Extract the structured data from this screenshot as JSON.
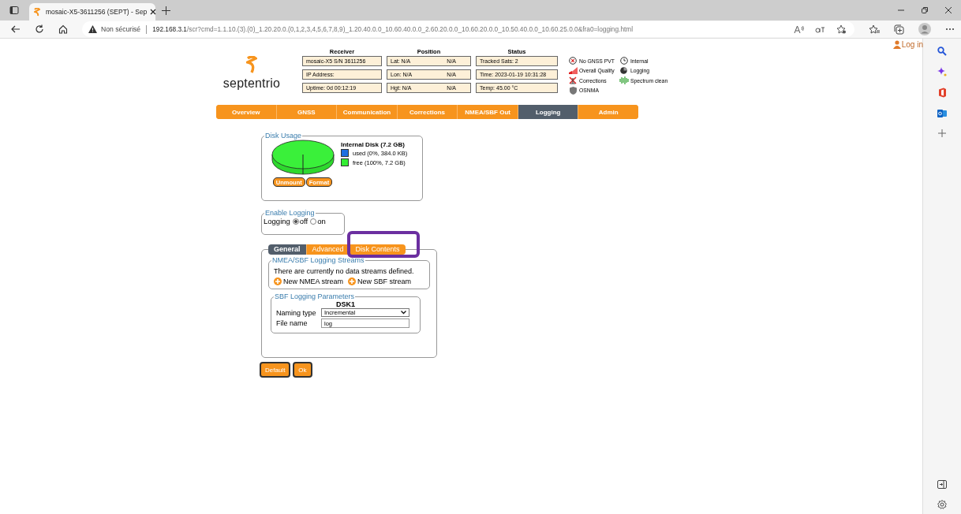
{
  "browser": {
    "tab_title": "mosaic-X5-3611256 (SEPT) - Sep",
    "security": "Non sécurisé",
    "url_host": "192.168.3.1",
    "url_path": "/scr?cmd=1.1.10.(3).(0)_1.20.20.0.(0,1,2,3,4,5,6,7,8,9)_1.20.40.0.0_10.60.40.0.0_2.60.20.0.0_10.60.20.0.0_10.50.40.0.0_10.60.25.0.0&fra0=logging.html"
  },
  "login": "Log in",
  "logo": "septentrio",
  "info_columns": [
    {
      "title": "Receiver",
      "cells": [
        [
          "mosaic-X5 S/N 3611256"
        ],
        [
          "IP Address:"
        ],
        [
          "Uptime: 0d 00:12:19"
        ]
      ]
    },
    {
      "title": "Position",
      "cells": [
        [
          "Lat: N/A",
          "N/A"
        ],
        [
          "Lon: N/A",
          "N/A"
        ],
        [
          "Hgt: N/A",
          "N/A"
        ]
      ]
    },
    {
      "title": "Status",
      "cells": [
        [
          "Tracked Sats: 2"
        ],
        [
          "Time: 2023-01-19 10:31:28"
        ],
        [
          "Temp: 45.00 °C"
        ]
      ]
    }
  ],
  "status_legend": [
    [
      "No GNSS PVT",
      "Overall Quality",
      "Corrections",
      "OSNMA"
    ],
    [
      "Internal",
      "Logging",
      "Spectrum clean"
    ]
  ],
  "nav": [
    {
      "label": "Overview",
      "selected": false
    },
    {
      "label": "GNSS",
      "selected": false
    },
    {
      "label": "Communication",
      "selected": false
    },
    {
      "label": "Corrections",
      "selected": false
    },
    {
      "label": "NMEA/SBF Out",
      "selected": false
    },
    {
      "label": "Logging",
      "selected": true
    },
    {
      "label": "Admin",
      "selected": false
    }
  ],
  "disk_usage": {
    "legend": "Disk Usage",
    "disk": "Internal Disk (7.2 GB)",
    "items": [
      {
        "label": "used (0%, 384.0 KB)",
        "color": "#1f6fe0"
      },
      {
        "label": "free (100%, 7.2 GB)",
        "color": "#33ee33"
      }
    ],
    "buttons": [
      "Unmount",
      "Format"
    ]
  },
  "enable_logging": {
    "legend": "Enable Logging",
    "label": "Logging",
    "options": [
      {
        "label": "off",
        "selected": true
      },
      {
        "label": "on",
        "selected": false
      }
    ]
  },
  "subtabs": [
    {
      "label": "General",
      "selected": true
    },
    {
      "label": "Advanced",
      "selected": false
    },
    {
      "label": "Disk Contents",
      "selected": false
    }
  ],
  "streams": {
    "legend": "NMEA/SBF Logging Streams",
    "message": "There are currently no data streams defined.",
    "actions": [
      "New NMEA stream",
      "New SBF stream"
    ]
  },
  "sbf_params": {
    "legend": "SBF Logging Parameters",
    "disk": "DSK1",
    "naming_label": "Naming type",
    "naming_value": "Incremental",
    "file_label": "File name",
    "file_value": "log"
  },
  "buttons": [
    "Default",
    "Ok"
  ]
}
